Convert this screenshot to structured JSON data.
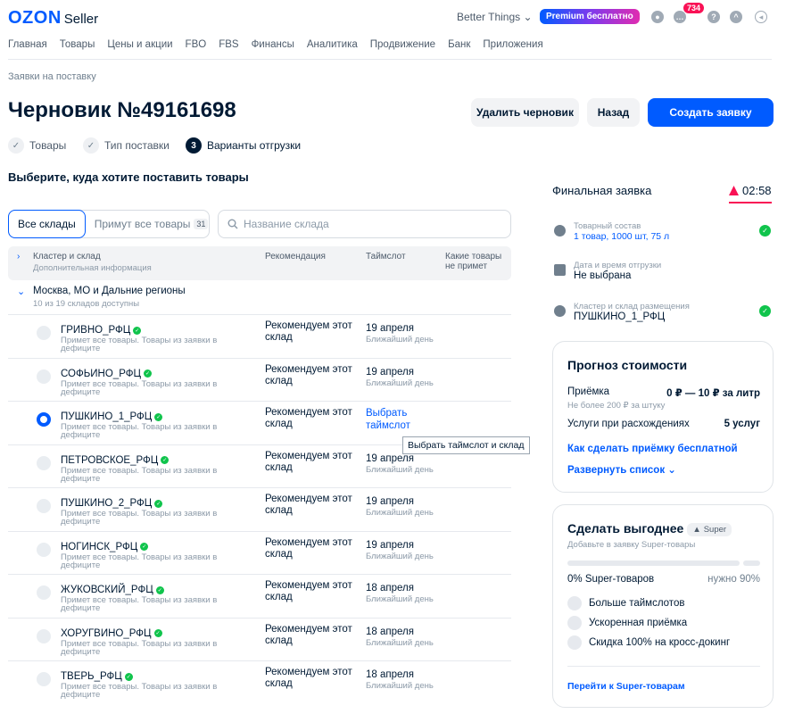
{
  "header": {
    "logo": "OZON",
    "logo_sub": "Seller",
    "account": "Better Things ⌄",
    "premium": "Premium бесплатно",
    "notif_count": "734"
  },
  "nav": [
    "Главная",
    "Товары",
    "Цены и акции",
    "FBO",
    "FBS",
    "Финансы",
    "Аналитика",
    "Продвижение",
    "Банк",
    "Приложения"
  ],
  "breadcrumb": "Заявки на поставку",
  "title": "Черновик №49161698",
  "buttons": {
    "delete": "Удалить черновик",
    "back": "Назад",
    "create": "Создать заявку"
  },
  "steps": [
    {
      "icon": "✓",
      "label": "Товары"
    },
    {
      "icon": "✓",
      "label": "Тип поставки"
    },
    {
      "icon": "3",
      "label": "Варианты отгрузки"
    }
  ],
  "choose_heading": "Выберите, куда хотите поставить товары",
  "tabs": {
    "all": "Все склады",
    "accept_all": "Примут все товары",
    "accept_count": "31"
  },
  "search_placeholder": "Название склада",
  "table": {
    "col_cluster": "Кластер и склад",
    "col_cluster_sub": "Дополнительная информация",
    "col_rec": "Рекомендация",
    "col_slot": "Таймслот",
    "col_reject": "Какие товары не примет"
  },
  "group": {
    "name": "Москва, МО и Дальние регионы",
    "sub": "10 из 19 складов доступны"
  },
  "warehouses": [
    {
      "name": "ГРИВНО_РФЦ",
      "sub": "Примет все товары. Товары из заявки в дефиците",
      "rec": "Рекомендуем этот склад",
      "date": "19 апреля",
      "day": "Ближайший день",
      "selected": false
    },
    {
      "name": "СОФЬИНО_РФЦ",
      "sub": "Примет все товары. Товары из заявки в дефиците",
      "rec": "Рекомендуем этот склад",
      "date": "19 апреля",
      "day": "Ближайший день",
      "selected": false
    },
    {
      "name": "ПУШКИНО_1_РФЦ",
      "sub": "Примет все товары. Товары из заявки в дефиците",
      "rec": "Рекомендуем этот склад",
      "date": "Выбрать таймслот",
      "day": "",
      "selected": true
    },
    {
      "name": "ПЕТРОВСКОЕ_РФЦ",
      "sub": "Примет все товары. Товары из заявки в дефиците",
      "rec": "Рекомендуем этот склад",
      "date": "19 апреля",
      "day": "Ближайший день",
      "selected": false
    },
    {
      "name": "ПУШКИНО_2_РФЦ",
      "sub": "Примет все товары. Товары из заявки в дефиците",
      "rec": "Рекомендуем этот склад",
      "date": "19 апреля",
      "day": "Ближайший день",
      "selected": false
    },
    {
      "name": "НОГИНСК_РФЦ",
      "sub": "Примет все товары. Товары из заявки в дефиците",
      "rec": "Рекомендуем этот склад",
      "date": "19 апреля",
      "day": "Ближайший день",
      "selected": false
    },
    {
      "name": "ЖУКОВСКИЙ_РФЦ",
      "sub": "Примет все товары. Товары из заявки в дефиците",
      "rec": "Рекомендуем этот склад",
      "date": "18 апреля",
      "day": "Ближайший день",
      "selected": false
    },
    {
      "name": "ХОРУГВИНО_РФЦ",
      "sub": "Примет все товары. Товары из заявки в дефиците",
      "rec": "Рекомендуем этот склад",
      "date": "18 апреля",
      "day": "Ближайший день",
      "selected": false
    },
    {
      "name": "ТВЕРЬ_РФЦ",
      "sub": "Примет все товары. Товары из заявки в дефиците",
      "rec": "Рекомендуем этот склад",
      "date": "18 апреля",
      "day": "Ближайший день",
      "selected": false
    }
  ],
  "tooltip": "Выбрать таймслот и склад",
  "summary": {
    "title": "Финальная заявка",
    "timer": "02:58",
    "items": [
      {
        "label": "Товарный состав",
        "value": "1 товар, 1000 шт, 75 л"
      },
      {
        "label": "Дата и время отгрузки",
        "value": "Не выбрана"
      },
      {
        "label": "Кластер и склад размещения",
        "value": "ПУШКИНО_1_РФЦ"
      }
    ]
  },
  "forecast": {
    "title": "Прогноз стоимости",
    "accept_label": "Приёмка",
    "accept_value": "0 ₽ — 10 ₽ за литр",
    "accept_note": "Не более 200 ₽ за штуку",
    "services_label": "Услуги при расхождениях",
    "services_value": "5 услуг",
    "link1": "Как сделать приёмку бесплатной",
    "link2": "Развернуть список ⌄"
  },
  "super": {
    "title": "Сделать выгоднее",
    "badge": "Super",
    "sub": "Добавьте в заявку Super-товары",
    "progress_left": "0% Super-товаров",
    "progress_right": "нужно 90%",
    "progress": 0,
    "features": [
      "Больше таймслотов",
      "Ускоренная приёмка",
      "Скидка 100% на кросс-докинг"
    ],
    "link": "Перейти к Super-товарам"
  },
  "colors": {
    "accent": "#005bff",
    "success": "#10c44c",
    "danger": "#f91155"
  }
}
